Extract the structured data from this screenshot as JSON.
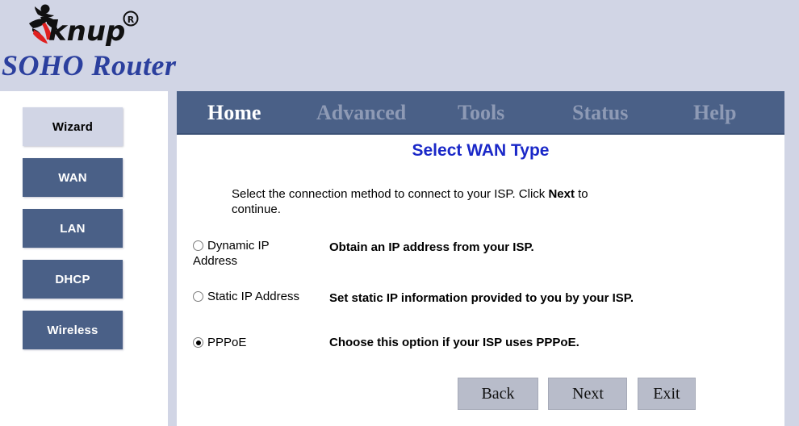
{
  "brand": {
    "logo_name": "knup-running-man-logo",
    "logo_text": "knup",
    "trademark": "®",
    "product_title": "SOHO Router"
  },
  "sidebar": {
    "items": [
      {
        "label": "Wizard",
        "active": true
      },
      {
        "label": "WAN",
        "active": false
      },
      {
        "label": "LAN",
        "active": false
      },
      {
        "label": "DHCP",
        "active": false
      },
      {
        "label": "Wireless",
        "active": false
      }
    ]
  },
  "nav": {
    "tabs": [
      {
        "label": "Home",
        "active": true
      },
      {
        "label": "Advanced",
        "active": false
      },
      {
        "label": "Tools",
        "active": false
      },
      {
        "label": "Status",
        "active": false
      },
      {
        "label": "Help",
        "active": false
      }
    ]
  },
  "main": {
    "title": "Select WAN Type",
    "intro_before": "Select the connection method to connect to your ISP. Click ",
    "intro_bold": "Next",
    "intro_after": " to continue.",
    "options": [
      {
        "label": "Dynamic IP Address",
        "description": "Obtain an IP address from your ISP.",
        "selected": false
      },
      {
        "label": "Static IP Address",
        "description": "Set static IP information provided to you by your ISP.",
        "selected": false
      },
      {
        "label": "PPPoE",
        "description": "Choose this option if your ISP uses PPPoE.",
        "selected": true
      }
    ]
  },
  "buttons": {
    "back": "Back",
    "next": "Next",
    "exit": "Exit"
  },
  "colors": {
    "header_bg": "#d1d5e5",
    "nav_bg": "#4a6087",
    "sidebar_button": "#4a6087",
    "sidebar_active": "#d1d5e5",
    "title_text": "#1a28c8",
    "brand_text": "#2b3f9e",
    "button_face": "#b8bcca"
  }
}
